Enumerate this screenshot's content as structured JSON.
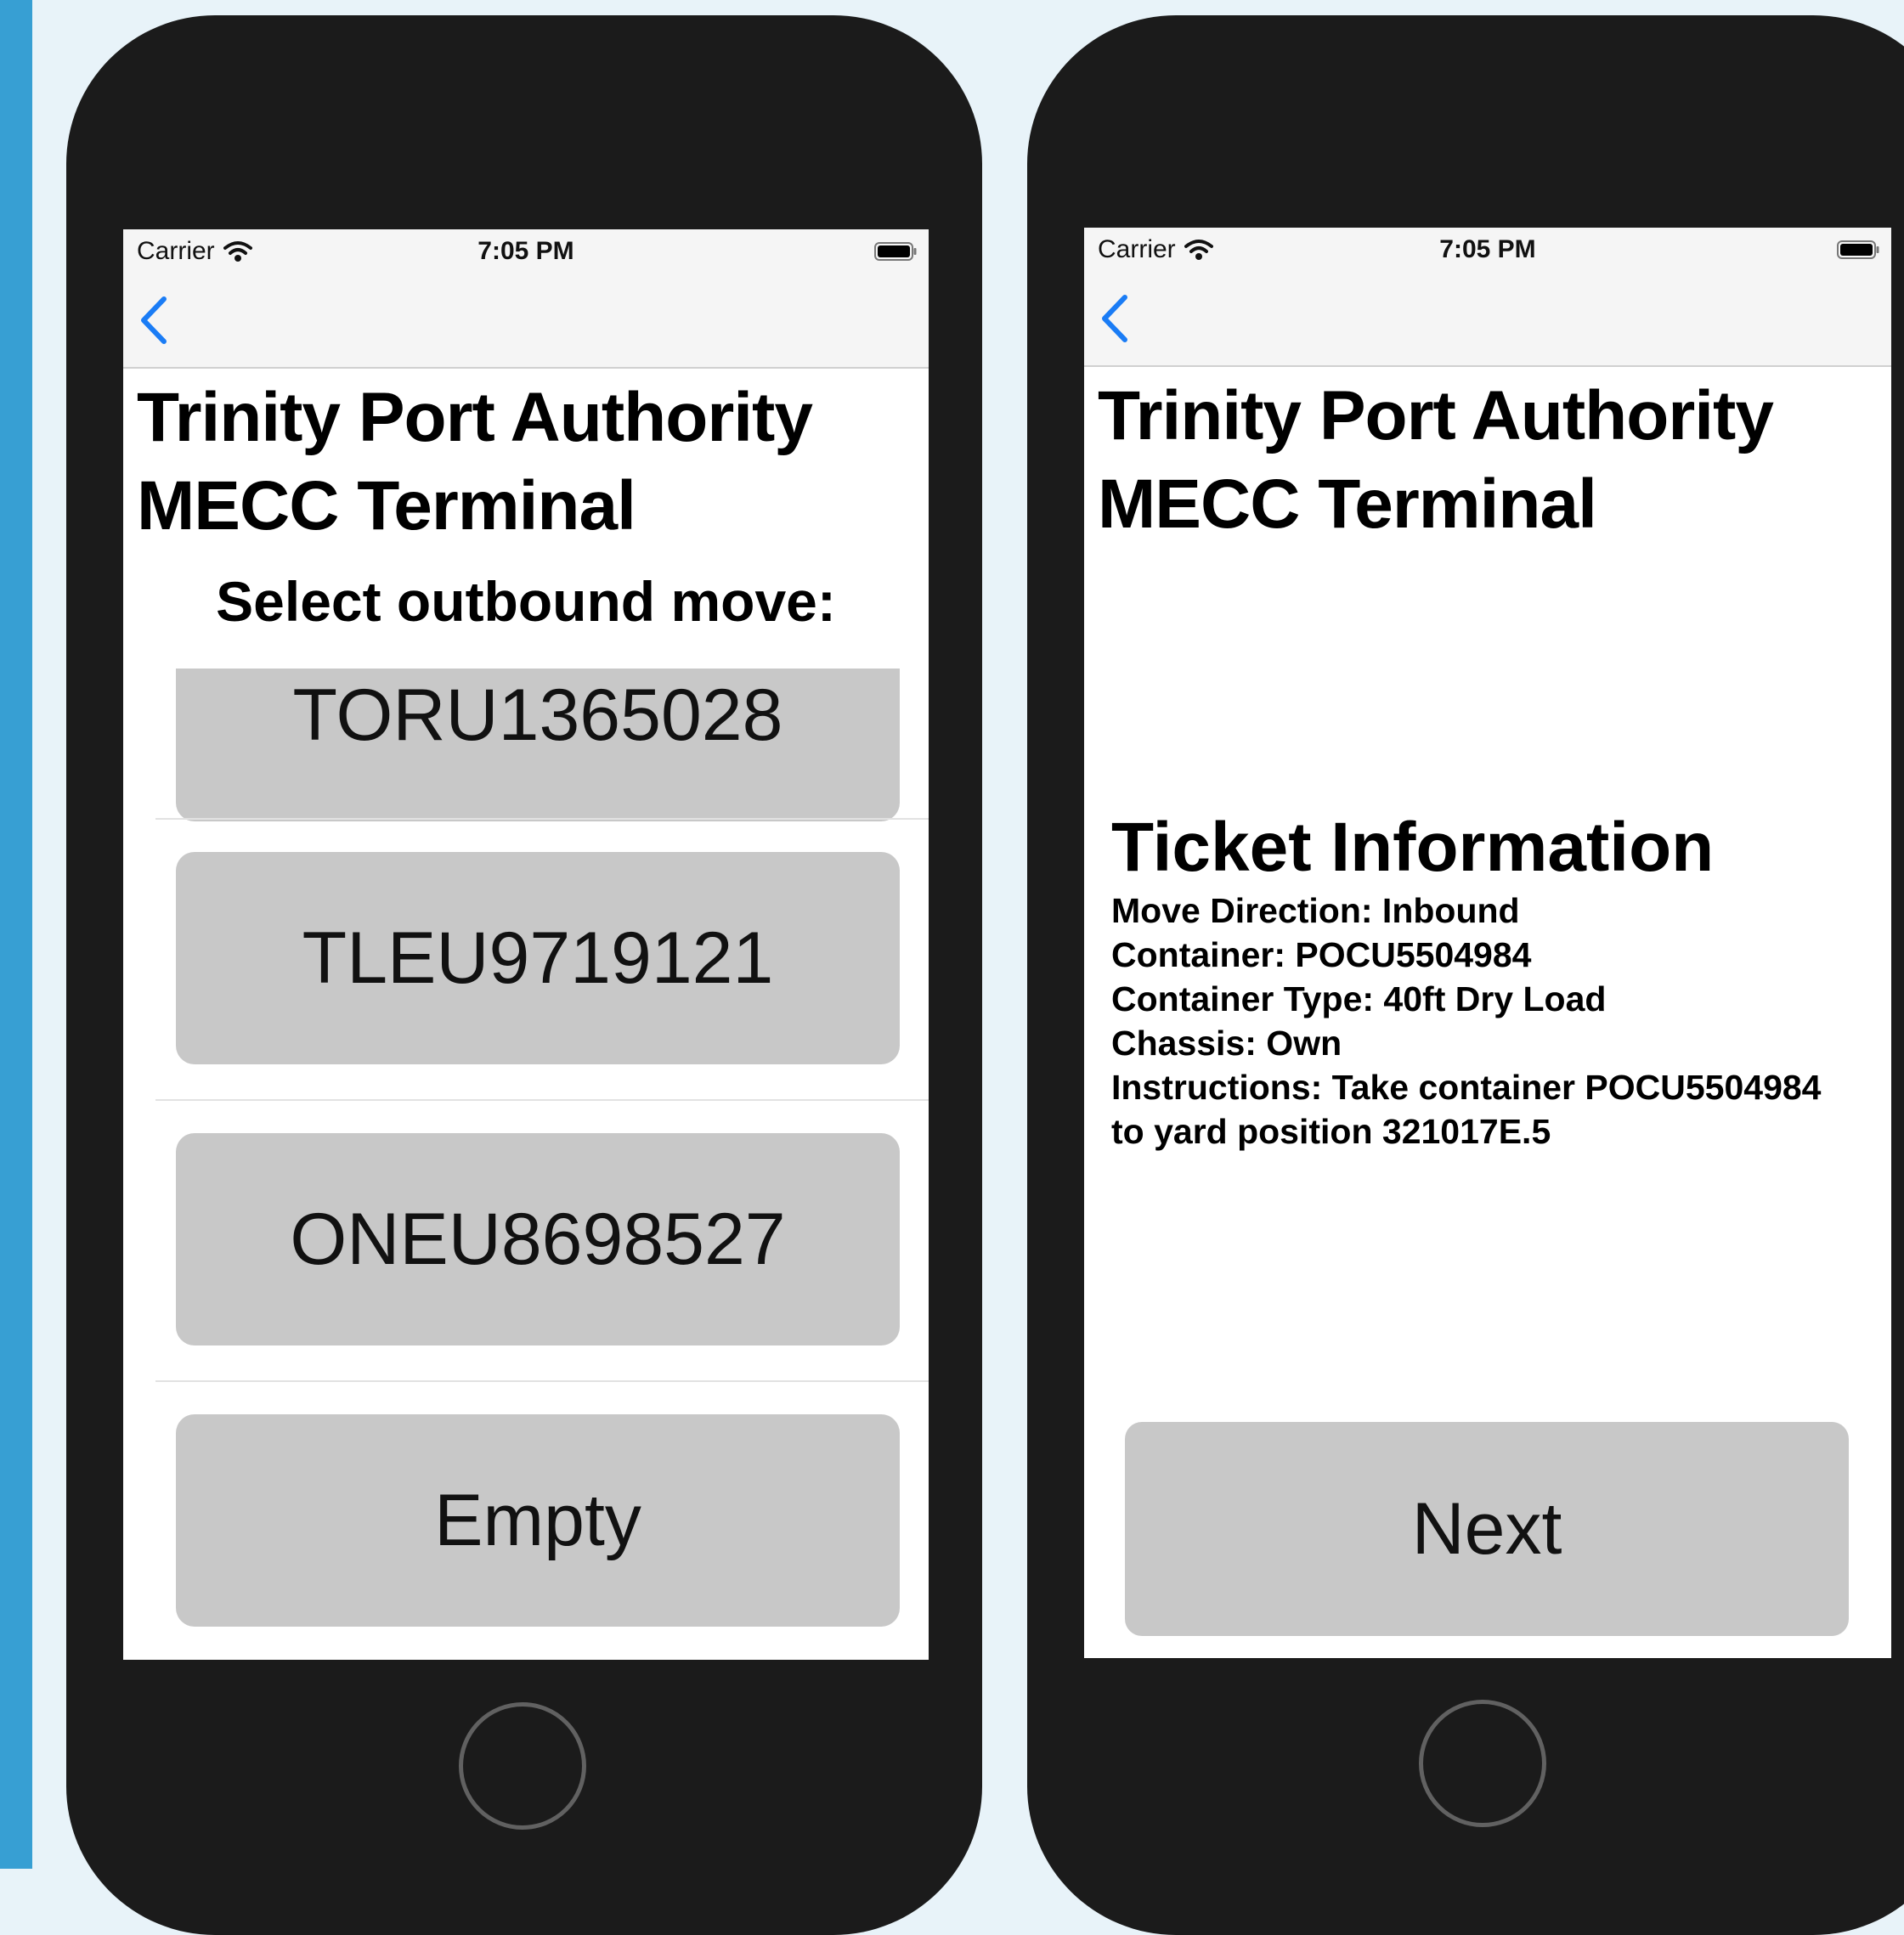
{
  "status": {
    "carrier": "Carrier",
    "time": "7:05 PM"
  },
  "header": {
    "title_line1": "Trinity Port Authority",
    "title_line2": "MECC Terminal"
  },
  "left_screen": {
    "subtitle": "Select outbound move:",
    "moves": [
      "TORU1365028",
      "TLEU9719121",
      "ONEU8698527",
      "Empty"
    ]
  },
  "right_screen": {
    "ticket_title": "Ticket Information",
    "fields": [
      "Move Direction: Inbound",
      "Container: POCU5504984",
      "Container Type: 40ft Dry Load",
      "Chassis: Own",
      "Instructions: Take container POCU5504984",
      "to yard position 321017E.5"
    ],
    "next_label": "Next"
  },
  "colors": {
    "accent": "#1a7cf5",
    "button": "#c8c8c8",
    "page_background": "#e8f3f9",
    "side_stripe": "#379fd3",
    "phone_body": "#1b1b1b"
  },
  "icons": [
    "wifi-icon",
    "battery-icon",
    "back-chevron-icon"
  ]
}
